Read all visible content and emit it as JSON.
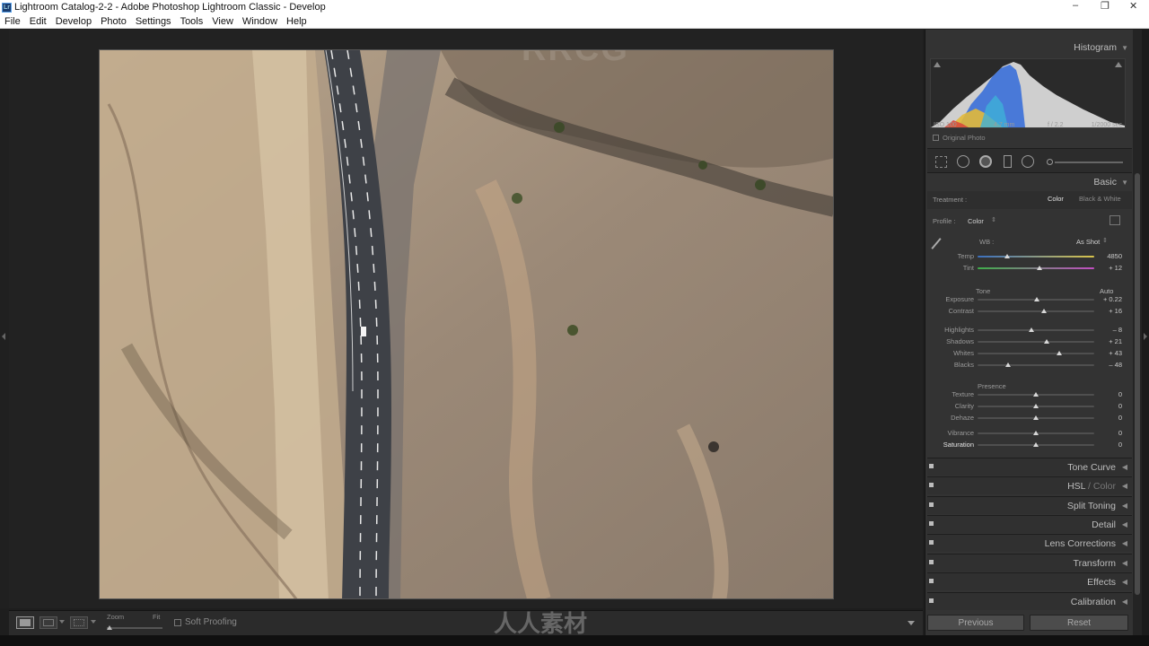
{
  "window": {
    "title": "Lightroom Catalog-2-2 - Adobe Photoshop Lightroom Classic - Develop",
    "app_icon": "Lr"
  },
  "window_controls": {
    "minimize": "–",
    "maximize": "❐",
    "close": "✕"
  },
  "menu": [
    "File",
    "Edit",
    "Develop",
    "Photo",
    "Settings",
    "Tools",
    "View",
    "Window",
    "Help"
  ],
  "histogram": {
    "title": "Histogram",
    "iso": "ISO 100",
    "focal": "4.7 mm",
    "aperture": "f / 2.2",
    "shutter": "1/2000 sec",
    "original_photo": "Original Photo"
  },
  "basic": {
    "title": "Basic",
    "treatment_label": "Treatment :",
    "treatment_color": "Color",
    "treatment_bw": "Black & White",
    "profile_label": "Profile :",
    "profile_value": "Color",
    "wb_label": "WB :",
    "wb_value": "As Shot",
    "tone_label": "Tone",
    "auto_label": "Auto",
    "presence_label": "Presence",
    "sliders": [
      {
        "label": "Temp",
        "value": "4850",
        "pos": 0.25
      },
      {
        "label": "Tint",
        "value": "+ 12",
        "pos": 0.53
      },
      {
        "label": "Exposure",
        "value": "+ 0.22",
        "pos": 0.51
      },
      {
        "label": "Contrast",
        "value": "+ 16",
        "pos": 0.57
      },
      {
        "label": "Highlights",
        "value": "– 8",
        "pos": 0.46
      },
      {
        "label": "Shadows",
        "value": "+ 21",
        "pos": 0.59
      },
      {
        "label": "Whites",
        "value": "+ 43",
        "pos": 0.7
      },
      {
        "label": "Blacks",
        "value": "– 48",
        "pos": 0.26
      },
      {
        "label": "Texture",
        "value": "0",
        "pos": 0.5
      },
      {
        "label": "Clarity",
        "value": "0",
        "pos": 0.5
      },
      {
        "label": "Dehaze",
        "value": "0",
        "pos": 0.5
      },
      {
        "label": "Vibrance",
        "value": "0",
        "pos": 0.5
      },
      {
        "label": "Saturation",
        "value": "0",
        "pos": 0.5
      }
    ]
  },
  "sections": {
    "tone_curve": "Tone Curve",
    "hsl_a": "HSL",
    "hsl_sep": " / ",
    "hsl_b": "Color",
    "split_toning": "Split Toning",
    "detail": "Detail",
    "lens_corrections": "Lens Corrections",
    "transform": "Transform",
    "effects": "Effects",
    "calibration": "Calibration"
  },
  "buttons": {
    "previous": "Previous",
    "reset": "Reset"
  },
  "toolbar": {
    "zoom_label": "Zoom",
    "fit_label": "Fit",
    "soft_proofing": "Soft Proofing"
  },
  "watermarks": {
    "top": "RRCG",
    "bottom": "人人素材"
  }
}
